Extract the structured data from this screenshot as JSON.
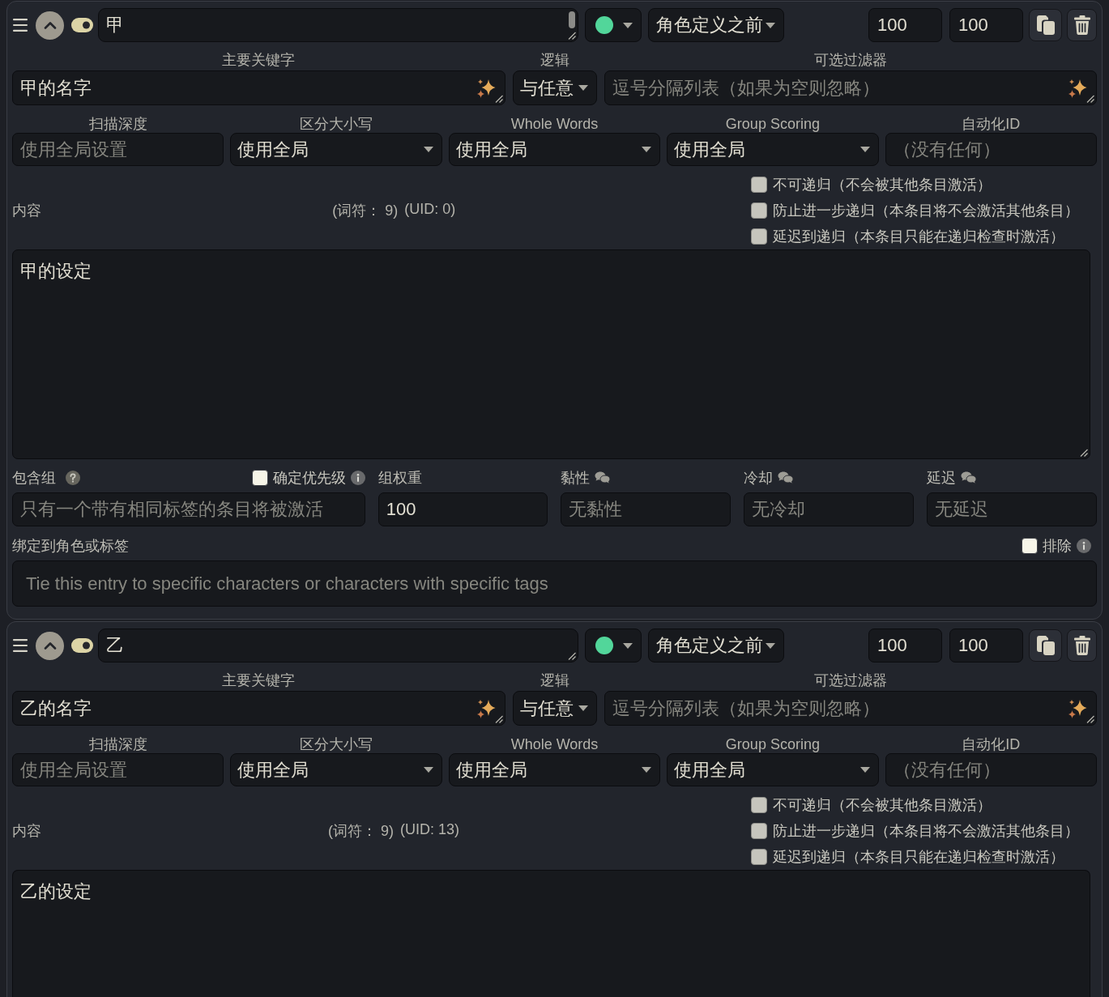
{
  "entries": [
    {
      "title": "甲",
      "title_scrollbar": true,
      "expanded": true,
      "enabled": true,
      "color": "#52d69a",
      "placement": "角色定义之前",
      "numbers": [
        "100",
        "100"
      ],
      "keywords": {
        "label": "主要关键字",
        "value": "甲的名字"
      },
      "logic": {
        "label": "逻辑",
        "value": "与任意"
      },
      "filter": {
        "label": "可选过滤器",
        "placeholder": "逗号分隔列表（如果为空则忽略）"
      },
      "settings": [
        {
          "kind": "input",
          "label": "扫描深度",
          "placeholder": "使用全局设置"
        },
        {
          "kind": "select",
          "label": "区分大小写",
          "value": "使用全局"
        },
        {
          "kind": "select",
          "label": "Whole Words",
          "value": "使用全局"
        },
        {
          "kind": "select",
          "label": "Group Scoring",
          "value": "使用全局"
        },
        {
          "kind": "input",
          "label": "自动化ID",
          "placeholder": "（没有任何）"
        }
      ],
      "content_label": "内容",
      "token_count": "(词符： 9)",
      "uid": "(UID: 0)",
      "recursion": [
        {
          "label": "不可递归（不会被其他条目激活）",
          "checked": false
        },
        {
          "label": "防止进一步递归（本条目将不会激活其他条目）",
          "checked": false
        },
        {
          "label": "延迟到递归（本条目只能在递归检查时激活）",
          "checked": false
        }
      ],
      "content": "甲的设定",
      "group": {
        "label": "包含组",
        "placeholder": "只有一个带有相同标签的条目将被激活"
      },
      "prioritize": {
        "label": "确定优先级",
        "checked": false
      },
      "timing": [
        {
          "kind": "plain",
          "label": "组权重",
          "value": "100"
        },
        {
          "kind": "chat",
          "label": "黏性",
          "placeholder": "无黏性"
        },
        {
          "kind": "chat",
          "label": "冷却",
          "placeholder": "无冷却"
        },
        {
          "kind": "chat",
          "label": "延迟",
          "placeholder": "无延迟"
        }
      ],
      "bind": {
        "label": "绑定到角色或标签",
        "placeholder": "Tie this entry to specific characters or characters with specific tags"
      },
      "exclude": {
        "label": "排除",
        "checked": false
      }
    },
    {
      "title": "乙",
      "title_scrollbar": false,
      "expanded": true,
      "enabled": true,
      "color": "#52d69a",
      "placement": "角色定义之前",
      "numbers": [
        "100",
        "100"
      ],
      "keywords": {
        "label": "主要关键字",
        "value": "乙的名字"
      },
      "logic": {
        "label": "逻辑",
        "value": "与任意"
      },
      "filter": {
        "label": "可选过滤器",
        "placeholder": "逗号分隔列表（如果为空则忽略）"
      },
      "settings": [
        {
          "kind": "input",
          "label": "扫描深度",
          "placeholder": "使用全局设置"
        },
        {
          "kind": "select",
          "label": "区分大小写",
          "value": "使用全局"
        },
        {
          "kind": "select",
          "label": "Whole Words",
          "value": "使用全局"
        },
        {
          "kind": "select",
          "label": "Group Scoring",
          "value": "使用全局"
        },
        {
          "kind": "input",
          "label": "自动化ID",
          "placeholder": "（没有任何）"
        }
      ],
      "content_label": "内容",
      "token_count": "(词符： 9)",
      "uid": "(UID: 13)",
      "recursion": [
        {
          "label": "不可递归（不会被其他条目激活）",
          "checked": false
        },
        {
          "label": "防止进一步递归（本条目将不会激活其他条目）",
          "checked": false
        },
        {
          "label": "延迟到递归（本条目只能在递归检查时激活）",
          "checked": false
        }
      ],
      "content": "乙的设定"
    }
  ]
}
